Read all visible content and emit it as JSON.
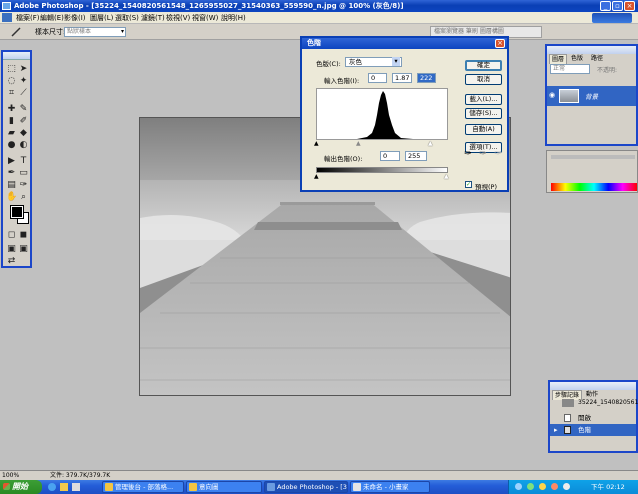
{
  "window": {
    "title": "Adobe Photoshop - [35224_1540820561548_1265955027_31540363_559590_n.jpg @ 100% (灰色/8)]"
  },
  "menu": [
    "檔案(F)",
    "編輯(E)",
    "影像(I)",
    "圖層(L)",
    "選取(S)",
    "濾鏡(T)",
    "檢視(V)",
    "視窗(W)",
    "說明(H)"
  ],
  "options": {
    "label": "樣本尺寸:",
    "dropdown": "點狀樣本",
    "browser_tab": "檔案瀏覽器 筆刷 圖層構圖"
  },
  "dialog": {
    "title": "色階",
    "channel_label": "色版(C):",
    "channel_value": "灰色",
    "input_label": "輸入色階(I):",
    "input_black": "0",
    "input_gamma": "1.87",
    "input_white": "222",
    "output_label": "輸出色階(O):",
    "output_black": "0",
    "output_white": "255",
    "buttons": [
      "確定",
      "取消",
      "載入(L)...",
      "儲存(S)...",
      "自動(A)",
      "選項(T)..."
    ],
    "preview_label": "預視(P)",
    "preview_checked": true
  },
  "layers": {
    "tabs": [
      "圖層",
      "色版",
      "路徑"
    ],
    "blend_mode": "正常",
    "opacity_label": "不透明:",
    "layer_name": "背景"
  },
  "history": {
    "tabs": [
      "步驟記錄",
      "動作"
    ],
    "snapshot": "35224_1540820561548...",
    "items": [
      "開啟",
      "色階"
    ]
  },
  "status": {
    "zoom": "100%",
    "doc_size": "文件: 379.7K/379.7K"
  },
  "taskbar": {
    "start": "開始",
    "tasks": [
      "管理後台 - 部落格...",
      "意向圖",
      "Adobe Photoshop - [3...",
      "未命名 - 小畫家"
    ],
    "clock": "下午 02:12"
  }
}
